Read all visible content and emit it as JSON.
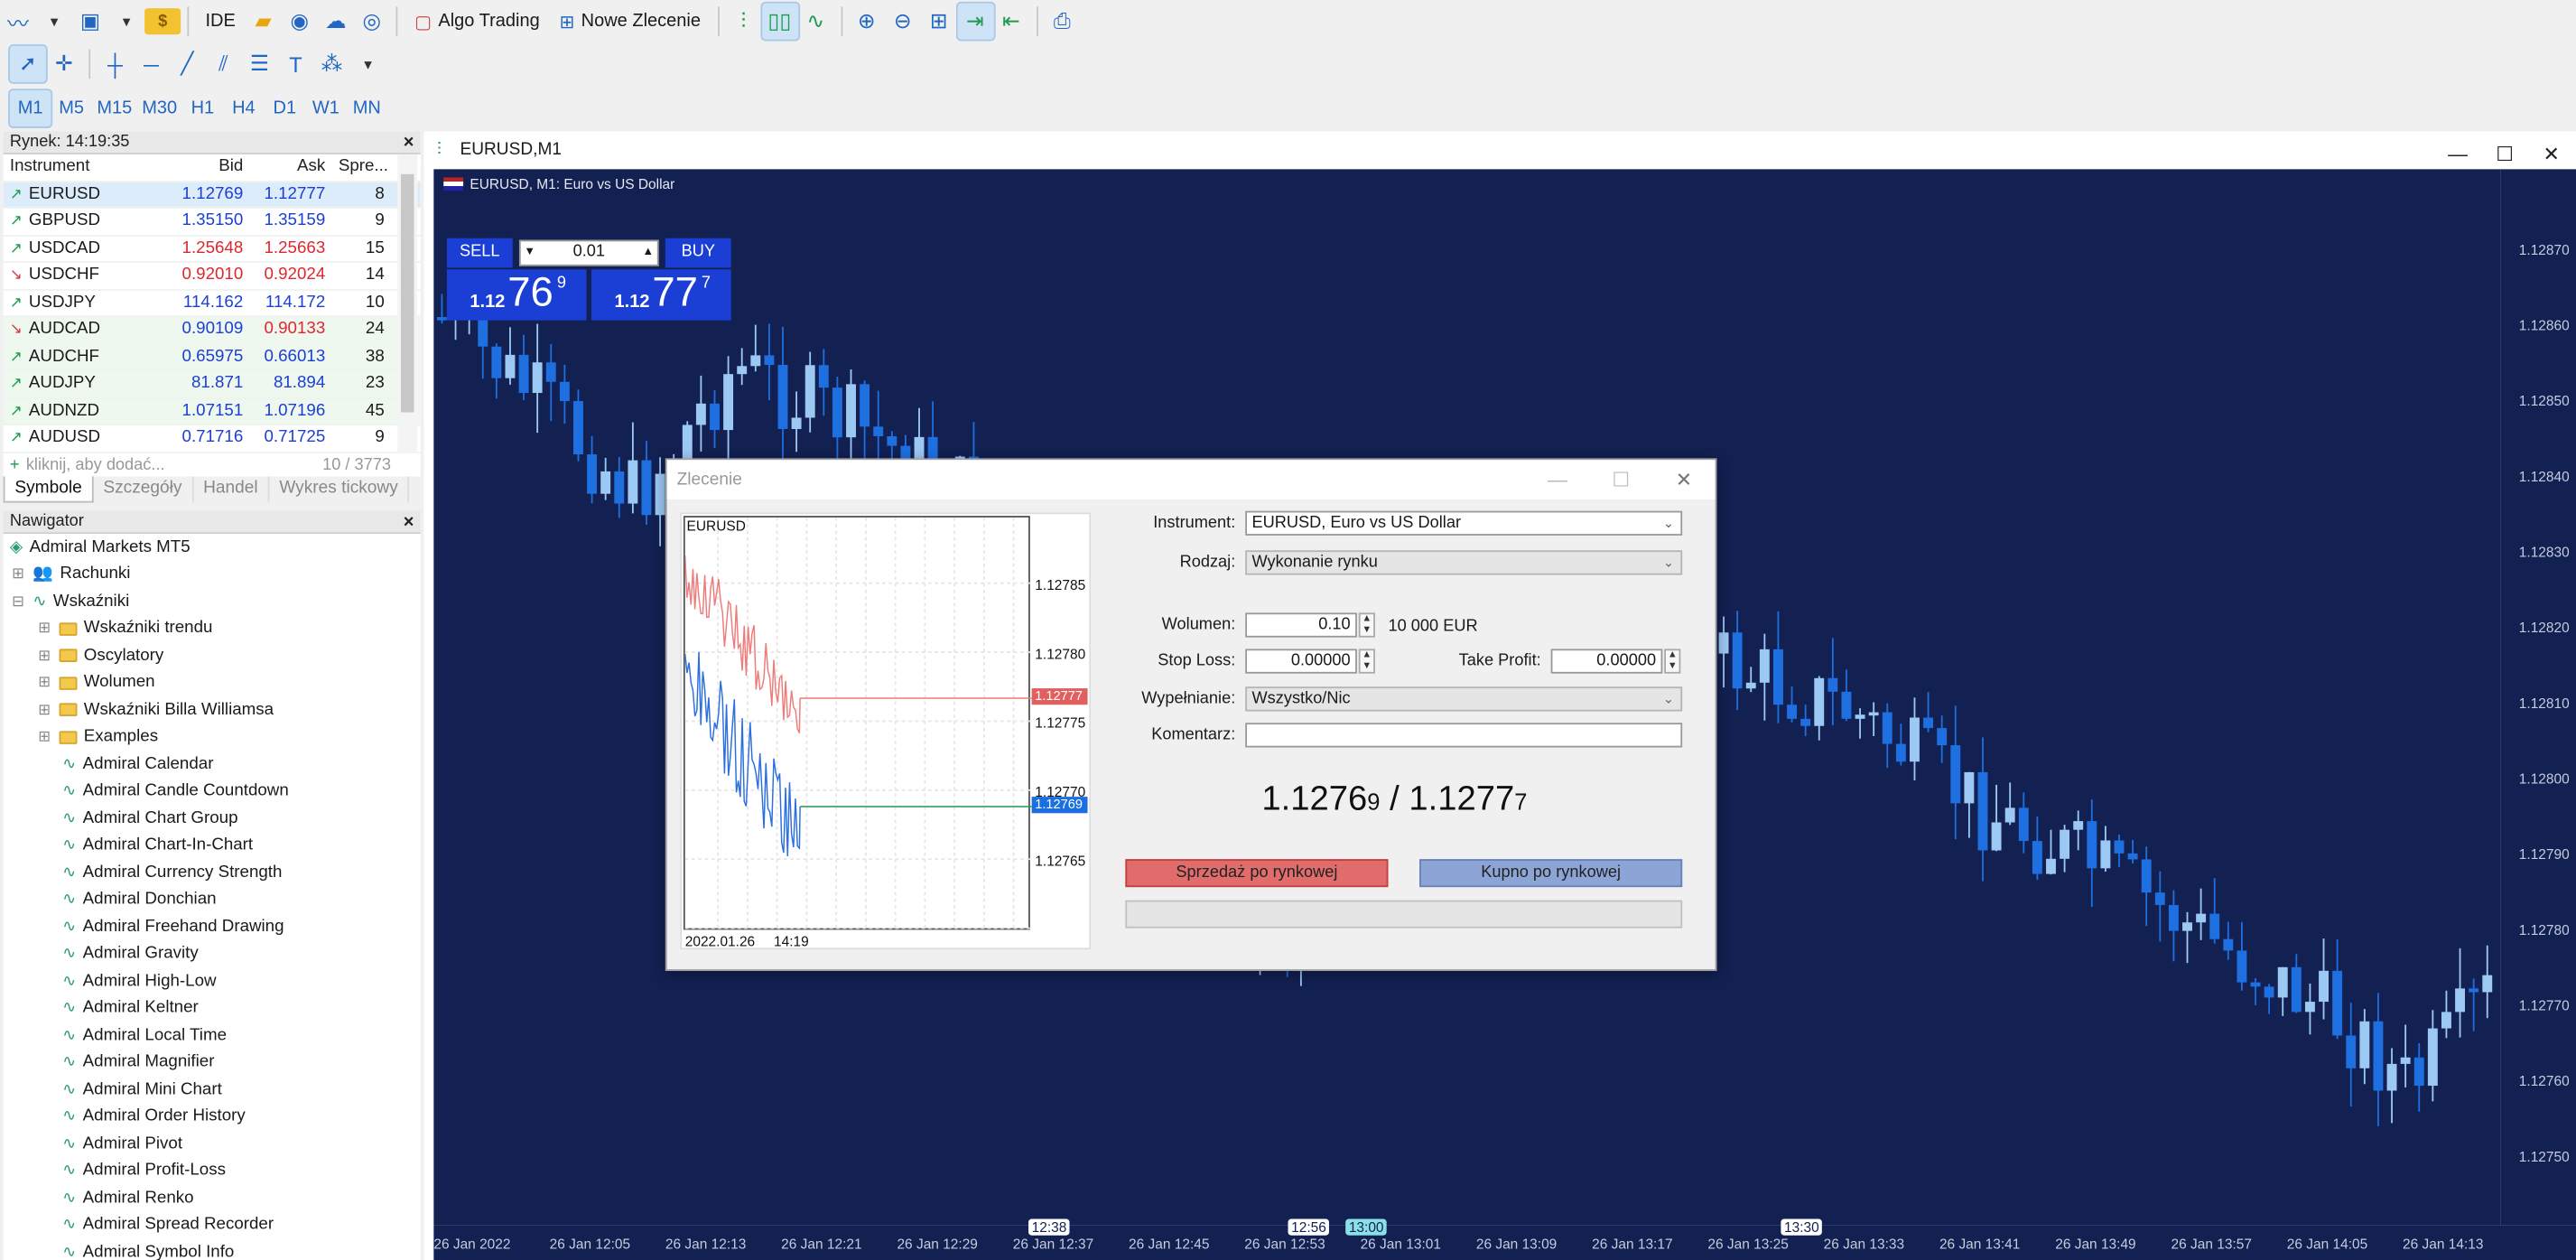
{
  "toolbar": {
    "algo_trading": "Algo Trading",
    "new_order": "Nowe Zlecenie",
    "ide": "IDE"
  },
  "timeframes": [
    "M1",
    "M5",
    "M15",
    "M30",
    "H1",
    "H4",
    "D1",
    "W1",
    "MN"
  ],
  "market_watch": {
    "title": "Rynek: 14:19:35",
    "columns": [
      "Instrument",
      "Bid",
      "Ask",
      "Spre..."
    ],
    "rows": [
      {
        "symbol": "EURUSD",
        "bid": "1.12769",
        "ask": "1.12777",
        "spread": "8",
        "dir": "up",
        "color": "blue"
      },
      {
        "symbol": "GBPUSD",
        "bid": "1.35150",
        "ask": "1.35159",
        "spread": "9",
        "dir": "up",
        "color": "blue"
      },
      {
        "symbol": "USDCAD",
        "bid": "1.25648",
        "ask": "1.25663",
        "spread": "15",
        "dir": "up",
        "color": "red"
      },
      {
        "symbol": "USDCHF",
        "bid": "0.92010",
        "ask": "0.92024",
        "spread": "14",
        "dir": "down",
        "color": "red"
      },
      {
        "symbol": "USDJPY",
        "bid": "114.162",
        "ask": "114.172",
        "spread": "10",
        "dir": "up",
        "color": "blue"
      },
      {
        "symbol": "AUDCAD",
        "bid": "0.90109",
        "ask": "0.90133",
        "spread": "24",
        "dir": "down",
        "color": "mixed"
      },
      {
        "symbol": "AUDCHF",
        "bid": "0.65975",
        "ask": "0.66013",
        "spread": "38",
        "dir": "up",
        "color": "blue"
      },
      {
        "symbol": "AUDJPY",
        "bid": "81.871",
        "ask": "81.894",
        "spread": "23",
        "dir": "up",
        "color": "blue"
      },
      {
        "symbol": "AUDNZD",
        "bid": "1.07151",
        "ask": "1.07196",
        "spread": "45",
        "dir": "up",
        "color": "blue"
      },
      {
        "symbol": "AUDUSD",
        "bid": "0.71716",
        "ask": "0.71725",
        "spread": "9",
        "dir": "up",
        "color": "blue"
      }
    ],
    "add_placeholder": "kliknij, aby dodać...",
    "count": "10 / 3773",
    "tabs": [
      "Symbole",
      "Szczegóły",
      "Handel",
      "Wykres tickowy"
    ]
  },
  "navigator": {
    "title": "Nawigator",
    "root": "Admiral Markets MT5",
    "accounts": "Rachunki",
    "indicators": "Wskaźniki",
    "folders": [
      "Wskaźniki trendu",
      "Oscylatory",
      "Wolumen",
      "Wskaźniki Billa Williamsa",
      "Examples"
    ],
    "items": [
      "Admiral Calendar",
      "Admiral Candle Countdown",
      "Admiral Chart Group",
      "Admiral Chart-In-Chart",
      "Admiral Currency Strength",
      "Admiral Donchian",
      "Admiral Freehand Drawing",
      "Admiral Gravity",
      "Admiral High-Low",
      "Admiral Keltner",
      "Admiral Local Time",
      "Admiral Magnifier",
      "Admiral Mini Chart",
      "Admiral Order History",
      "Admiral Pivot",
      "Admiral Profit-Loss",
      "Admiral Renko",
      "Admiral Spread Recorder",
      "Admiral Symbol Info"
    ]
  },
  "chart": {
    "window_title": "EURUSD,M1",
    "subtitle": "EURUSD, M1:  Euro vs US Dollar",
    "sell_label": "SELL",
    "buy_label": "BUY",
    "volume": "0.01",
    "sell_small": "1.12",
    "sell_big": "76",
    "sell_sup": "9",
    "buy_small": "1.12",
    "buy_big": "77",
    "buy_sup": "7",
    "y_labels": [
      "1.12870",
      "1.12860",
      "1.12850",
      "1.12840",
      "1.12830",
      "1.12820",
      "1.12810",
      "1.12800",
      "1.12790",
      "1.12780",
      "1.12770",
      "1.12760",
      "1.12750"
    ],
    "x_labels": [
      "26 Jan 2022",
      "26 Jan 12:05",
      "26 Jan 12:13",
      "26 Jan 12:21",
      "26 Jan 12:29",
      "26 Jan 12:37",
      "26 Jan 12:45",
      "26 Jan 12:53",
      "26 Jan 13:01",
      "26 Jan 13:09",
      "26 Jan 13:17",
      "26 Jan 13:25",
      "26 Jan 13:33",
      "26 Jan 13:41",
      "26 Jan 13:49",
      "26 Jan 13:57",
      "26 Jan 14:05",
      "26 Jan 14:13"
    ],
    "markers": [
      "12:38",
      "12:56",
      "13:00",
      "13:30"
    ],
    "colors": {
      "background": "#122052",
      "bull": "#9cc8f4",
      "bear": "#1e6fe0"
    }
  },
  "dialog": {
    "title": "Zlecenie",
    "mini_symbol": "EURUSD",
    "mini_y": [
      "1.12785",
      "1.12780",
      "1.12775",
      "1.12770",
      "1.12765"
    ],
    "mini_ask_tag": "1.12777",
    "mini_bid_tag": "1.12769",
    "mini_date": "2022.01.26",
    "mini_time": "14:19",
    "instrument_label": "Instrument:",
    "instrument_value": "EURUSD, Euro vs US Dollar",
    "type_label": "Rodzaj:",
    "type_value": "Wykonanie rynku",
    "volume_label": "Wolumen:",
    "volume_value": "0.10",
    "volume_note": "10 000 EUR",
    "sl_label": "Stop Loss:",
    "sl_value": "0.00000",
    "tp_label": "Take Profit:",
    "tp_value": "0.00000",
    "fill_label": "Wypełnianie:",
    "fill_value": "Wszystko/Nic",
    "comment_label": "Komentarz:",
    "comment_value": "",
    "quote_bid_main": "1.1276",
    "quote_bid_small": "9",
    "quote_sep": " / ",
    "quote_ask_main": "1.1277",
    "quote_ask_small": "7",
    "sell_button": "Sprzedaż po rynkowej",
    "buy_button": "Kupno po rynkowej"
  }
}
